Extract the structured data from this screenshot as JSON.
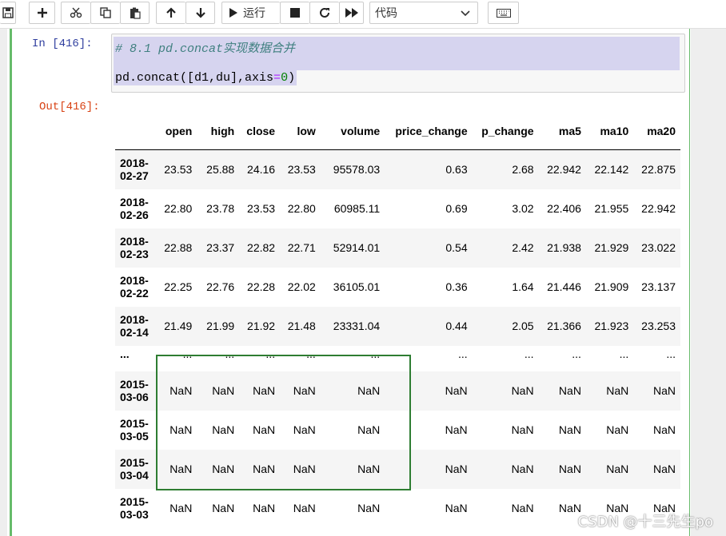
{
  "toolbar": {
    "run_label": "运行",
    "cell_type_selected": "代码",
    "buttons": [
      "save-icon",
      "add-cell-icon",
      "cut-icon",
      "copy-icon",
      "paste-icon",
      "move-up-icon",
      "move-down-icon",
      "run-icon",
      "stop-icon",
      "restart-icon",
      "fast-forward-icon",
      "keyboard-icon"
    ]
  },
  "cell": {
    "in_prompt": "In  [416]:",
    "out_prompt": "Out[416]:",
    "code_comment": "# 8.1 pd.concat实现数据合并",
    "code_statement": "pd.concat([d1,du],axis=0)"
  },
  "dataframe": {
    "columns": [
      "",
      "open",
      "high",
      "close",
      "low",
      "volume",
      "price_change",
      "p_change",
      "ma5",
      "ma10",
      "ma20"
    ],
    "rows": [
      {
        "index": [
          "2018-",
          "02-27"
        ],
        "values": [
          "23.53",
          "25.88",
          "24.16",
          "23.53",
          "95578.03",
          "0.63",
          "2.68",
          "22.942",
          "22.142",
          "22.875"
        ]
      },
      {
        "index": [
          "2018-",
          "02-26"
        ],
        "values": [
          "22.80",
          "23.78",
          "23.53",
          "22.80",
          "60985.11",
          "0.69",
          "3.02",
          "22.406",
          "21.955",
          "22.942"
        ]
      },
      {
        "index": [
          "2018-",
          "02-23"
        ],
        "values": [
          "22.88",
          "23.37",
          "22.82",
          "22.71",
          "52914.01",
          "0.54",
          "2.42",
          "21.938",
          "21.929",
          "23.022"
        ]
      },
      {
        "index": [
          "2018-",
          "02-22"
        ],
        "values": [
          "22.25",
          "22.76",
          "22.28",
          "22.02",
          "36105.01",
          "0.36",
          "1.64",
          "21.446",
          "21.909",
          "23.137"
        ]
      },
      {
        "index": [
          "2018-",
          "02-14"
        ],
        "values": [
          "21.49",
          "21.99",
          "21.92",
          "21.48",
          "23331.04",
          "0.44",
          "2.05",
          "21.366",
          "21.923",
          "23.253"
        ]
      },
      {
        "index": [
          "...",
          ""
        ],
        "values": [
          "...",
          "...",
          "...",
          "...",
          "...",
          "...",
          "...",
          "...",
          "...",
          "..."
        ]
      },
      {
        "index": [
          "2015-",
          "03-06"
        ],
        "values": [
          "NaN",
          "NaN",
          "NaN",
          "NaN",
          "NaN",
          "NaN",
          "NaN",
          "NaN",
          "NaN",
          "NaN"
        ]
      },
      {
        "index": [
          "2015-",
          "03-05"
        ],
        "values": [
          "NaN",
          "NaN",
          "NaN",
          "NaN",
          "NaN",
          "NaN",
          "NaN",
          "NaN",
          "NaN",
          "NaN"
        ]
      },
      {
        "index": [
          "2015-",
          "03-04"
        ],
        "values": [
          "NaN",
          "NaN",
          "NaN",
          "NaN",
          "NaN",
          "NaN",
          "NaN",
          "NaN",
          "NaN",
          "NaN"
        ]
      },
      {
        "index": [
          "2015-",
          "03-03"
        ],
        "values": [
          "NaN",
          "NaN",
          "NaN",
          "NaN",
          "NaN",
          "NaN",
          "NaN",
          "NaN",
          "NaN",
          "NaN"
        ]
      }
    ]
  },
  "watermark": "CSDN @十三先生po",
  "colors": {
    "cell_border_green": "#66bb6a",
    "highlight_box": "#2e7d32",
    "selection": "#d6d4ef",
    "in_prompt": "#303f9f",
    "out_prompt": "#d84315"
  }
}
